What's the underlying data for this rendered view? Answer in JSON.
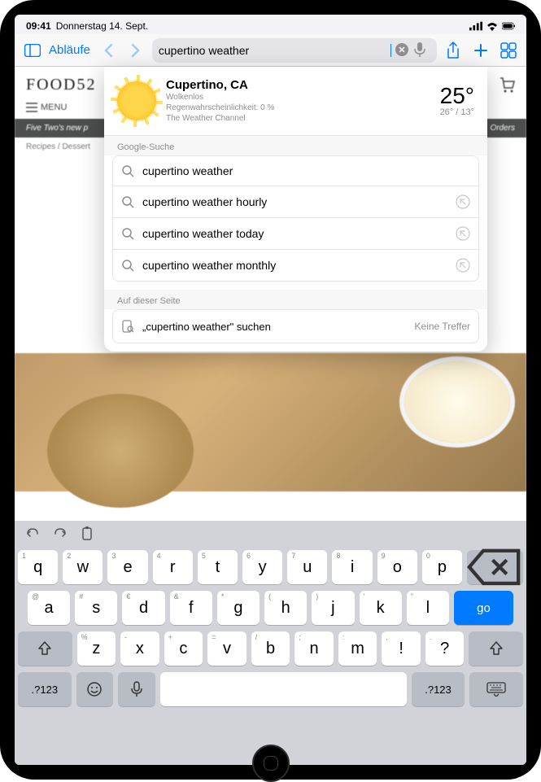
{
  "status": {
    "time": "09:41",
    "date": "Donnerstag 14. Sept."
  },
  "toolbar": {
    "sidebar_label": "Abläufe",
    "search_value": "cupertino weather"
  },
  "weather": {
    "location": "Cupertino, CA",
    "condition": "Wolkenlos",
    "rain": "Regenwahrscheinlichkeit: 0 %",
    "source": "The Weather Channel",
    "temp": "25°",
    "hi_lo": "26° / 13°"
  },
  "sections": {
    "google": "Google-Suche",
    "onpage": "Auf dieser Seite"
  },
  "suggestions": [
    {
      "text": "cupertino weather",
      "fill": false
    },
    {
      "text": "cupertino weather hourly",
      "fill": true
    },
    {
      "text": "cupertino weather today",
      "fill": true
    },
    {
      "text": "cupertino weather monthly",
      "fill": true
    }
  ],
  "onpage": {
    "query_label": "„cupertino weather\" suchen",
    "result": "Keine Treffer"
  },
  "page": {
    "brand": "FOOD52",
    "menu": "MENU",
    "promo_left": "Five Two's new p",
    "promo_right": "Orders",
    "breadcrumb": "Recipes / Dessert"
  },
  "keyboard": {
    "row1": [
      {
        "k": "q",
        "h": "1"
      },
      {
        "k": "w",
        "h": "2"
      },
      {
        "k": "e",
        "h": "3"
      },
      {
        "k": "r",
        "h": "4"
      },
      {
        "k": "t",
        "h": "5"
      },
      {
        "k": "y",
        "h": "6"
      },
      {
        "k": "u",
        "h": "7"
      },
      {
        "k": "i",
        "h": "8"
      },
      {
        "k": "o",
        "h": "9"
      },
      {
        "k": "p",
        "h": "0"
      }
    ],
    "row2": [
      {
        "k": "a",
        "h": "@"
      },
      {
        "k": "s",
        "h": "#"
      },
      {
        "k": "d",
        "h": "€"
      },
      {
        "k": "f",
        "h": "&"
      },
      {
        "k": "g",
        "h": "*"
      },
      {
        "k": "h",
        "h": "("
      },
      {
        "k": "j",
        "h": ")"
      },
      {
        "k": "k",
        "h": "'"
      },
      {
        "k": "l",
        "h": "\""
      }
    ],
    "row3": [
      {
        "k": "z",
        "h": "%"
      },
      {
        "k": "x",
        "h": "-"
      },
      {
        "k": "c",
        "h": "+"
      },
      {
        "k": "v",
        "h": "="
      },
      {
        "k": "b",
        "h": "/"
      },
      {
        "k": "n",
        "h": ";"
      },
      {
        "k": "m",
        "h": ":"
      }
    ],
    "punct": {
      "k": "!",
      "h": ","
    },
    "ques": {
      "k": "?",
      "h": "."
    },
    "go_label": "go",
    "numkey": ".?123"
  }
}
